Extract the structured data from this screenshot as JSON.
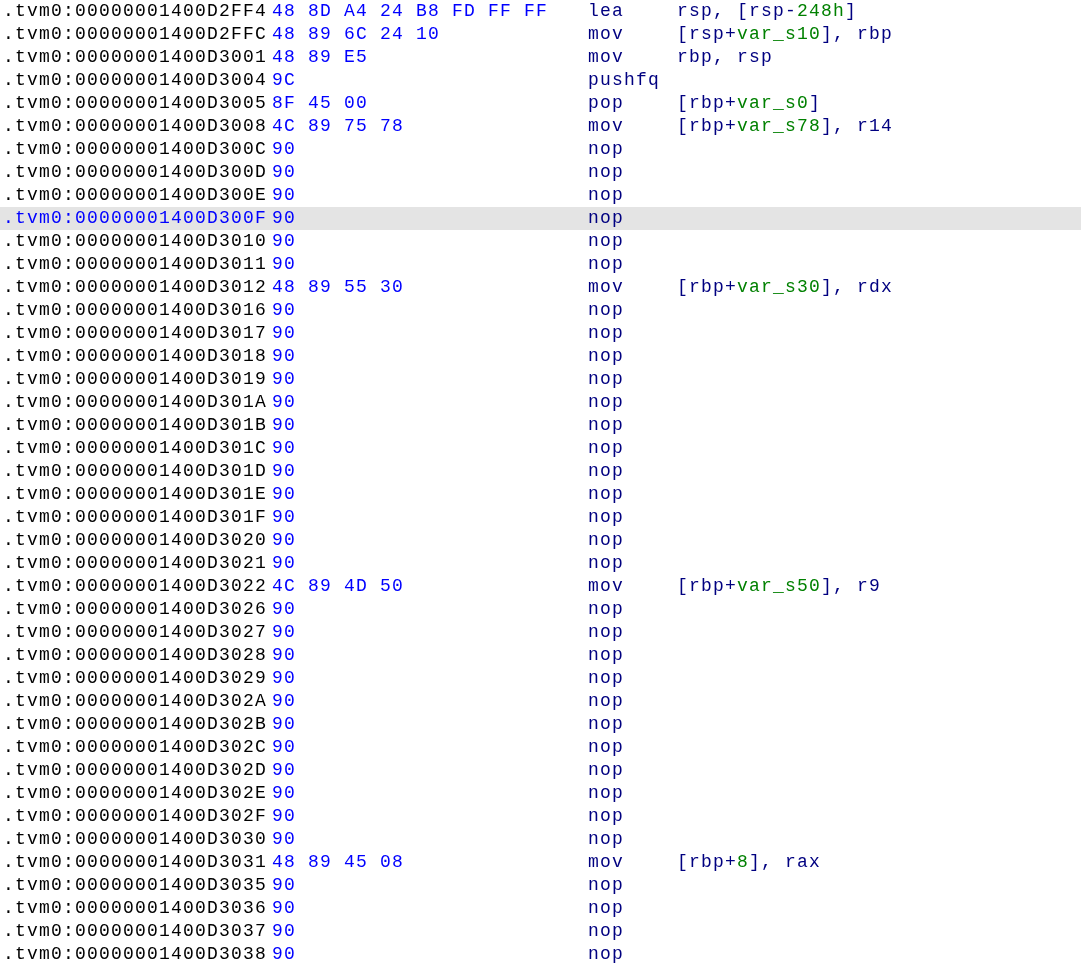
{
  "listing": {
    "rows": [
      {
        "address": ".tvm0:00000001400D2FF4",
        "bytes": "48 8D A4 24 B8 FD FF FF",
        "mnemonic": "lea",
        "operands": [
          {
            "text": "rsp, [rsp-",
            "kind": "plain"
          },
          {
            "text": "248h",
            "kind": "symbol"
          },
          {
            "text": "]",
            "kind": "plain"
          }
        ],
        "selected": false
      },
      {
        "address": ".tvm0:00000001400D2FFC",
        "bytes": "48 89 6C 24 10",
        "mnemonic": "mov",
        "operands": [
          {
            "text": "[rsp+",
            "kind": "plain"
          },
          {
            "text": "var_s10",
            "kind": "symbol"
          },
          {
            "text": "], rbp",
            "kind": "plain"
          }
        ],
        "selected": false
      },
      {
        "address": ".tvm0:00000001400D3001",
        "bytes": "48 89 E5",
        "mnemonic": "mov",
        "operands": [
          {
            "text": "rbp, rsp",
            "kind": "plain"
          }
        ],
        "selected": false
      },
      {
        "address": ".tvm0:00000001400D3004",
        "bytes": "9C",
        "mnemonic": "pushfq",
        "selected": false
      },
      {
        "address": ".tvm0:00000001400D3005",
        "bytes": "8F 45 00",
        "mnemonic": "pop",
        "operands": [
          {
            "text": "[rbp+",
            "kind": "plain"
          },
          {
            "text": "var_s0",
            "kind": "symbol"
          },
          {
            "text": "]",
            "kind": "plain"
          }
        ],
        "selected": false
      },
      {
        "address": ".tvm0:00000001400D3008",
        "bytes": "4C 89 75 78",
        "mnemonic": "mov",
        "operands": [
          {
            "text": "[rbp+",
            "kind": "plain"
          },
          {
            "text": "var_s78",
            "kind": "symbol"
          },
          {
            "text": "], r14",
            "kind": "plain"
          }
        ],
        "selected": false
      },
      {
        "address": ".tvm0:00000001400D300C",
        "bytes": "90",
        "mnemonic": "nop",
        "selected": false
      },
      {
        "address": ".tvm0:00000001400D300D",
        "bytes": "90",
        "mnemonic": "nop",
        "selected": false
      },
      {
        "address": ".tvm0:00000001400D300E",
        "bytes": "90",
        "mnemonic": "nop",
        "selected": false
      },
      {
        "address": ".tvm0:00000001400D300F",
        "bytes": "90",
        "mnemonic": "nop",
        "selected": true
      },
      {
        "address": ".tvm0:00000001400D3010",
        "bytes": "90",
        "mnemonic": "nop",
        "selected": false
      },
      {
        "address": ".tvm0:00000001400D3011",
        "bytes": "90",
        "mnemonic": "nop",
        "selected": false
      },
      {
        "address": ".tvm0:00000001400D3012",
        "bytes": "48 89 55 30",
        "mnemonic": "mov",
        "operands": [
          {
            "text": "[rbp+",
            "kind": "plain"
          },
          {
            "text": "var_s30",
            "kind": "symbol"
          },
          {
            "text": "], rdx",
            "kind": "plain"
          }
        ],
        "selected": false
      },
      {
        "address": ".tvm0:00000001400D3016",
        "bytes": "90",
        "mnemonic": "nop",
        "selected": false
      },
      {
        "address": ".tvm0:00000001400D3017",
        "bytes": "90",
        "mnemonic": "nop",
        "selected": false
      },
      {
        "address": ".tvm0:00000001400D3018",
        "bytes": "90",
        "mnemonic": "nop",
        "selected": false
      },
      {
        "address": ".tvm0:00000001400D3019",
        "bytes": "90",
        "mnemonic": "nop",
        "selected": false
      },
      {
        "address": ".tvm0:00000001400D301A",
        "bytes": "90",
        "mnemonic": "nop",
        "selected": false
      },
      {
        "address": ".tvm0:00000001400D301B",
        "bytes": "90",
        "mnemonic": "nop",
        "selected": false
      },
      {
        "address": ".tvm0:00000001400D301C",
        "bytes": "90",
        "mnemonic": "nop",
        "selected": false
      },
      {
        "address": ".tvm0:00000001400D301D",
        "bytes": "90",
        "mnemonic": "nop",
        "selected": false
      },
      {
        "address": ".tvm0:00000001400D301E",
        "bytes": "90",
        "mnemonic": "nop",
        "selected": false
      },
      {
        "address": ".tvm0:00000001400D301F",
        "bytes": "90",
        "mnemonic": "nop",
        "selected": false
      },
      {
        "address": ".tvm0:00000001400D3020",
        "bytes": "90",
        "mnemonic": "nop",
        "selected": false
      },
      {
        "address": ".tvm0:00000001400D3021",
        "bytes": "90",
        "mnemonic": "nop",
        "selected": false
      },
      {
        "address": ".tvm0:00000001400D3022",
        "bytes": "4C 89 4D 50",
        "mnemonic": "mov",
        "operands": [
          {
            "text": "[rbp+",
            "kind": "plain"
          },
          {
            "text": "var_s50",
            "kind": "symbol"
          },
          {
            "text": "], r9",
            "kind": "plain"
          }
        ],
        "selected": false
      },
      {
        "address": ".tvm0:00000001400D3026",
        "bytes": "90",
        "mnemonic": "nop",
        "selected": false
      },
      {
        "address": ".tvm0:00000001400D3027",
        "bytes": "90",
        "mnemonic": "nop",
        "selected": false
      },
      {
        "address": ".tvm0:00000001400D3028",
        "bytes": "90",
        "mnemonic": "nop",
        "selected": false
      },
      {
        "address": ".tvm0:00000001400D3029",
        "bytes": "90",
        "mnemonic": "nop",
        "selected": false
      },
      {
        "address": ".tvm0:00000001400D302A",
        "bytes": "90",
        "mnemonic": "nop",
        "selected": false
      },
      {
        "address": ".tvm0:00000001400D302B",
        "bytes": "90",
        "mnemonic": "nop",
        "selected": false
      },
      {
        "address": ".tvm0:00000001400D302C",
        "bytes": "90",
        "mnemonic": "nop",
        "selected": false
      },
      {
        "address": ".tvm0:00000001400D302D",
        "bytes": "90",
        "mnemonic": "nop",
        "selected": false
      },
      {
        "address": ".tvm0:00000001400D302E",
        "bytes": "90",
        "mnemonic": "nop",
        "selected": false
      },
      {
        "address": ".tvm0:00000001400D302F",
        "bytes": "90",
        "mnemonic": "nop",
        "selected": false
      },
      {
        "address": ".tvm0:00000001400D3030",
        "bytes": "90",
        "mnemonic": "nop",
        "selected": false
      },
      {
        "address": ".tvm0:00000001400D3031",
        "bytes": "48 89 45 08",
        "mnemonic": "mov",
        "operands": [
          {
            "text": "[rbp+",
            "kind": "plain"
          },
          {
            "text": "8",
            "kind": "symbol"
          },
          {
            "text": "], rax",
            "kind": "plain"
          }
        ],
        "selected": false
      },
      {
        "address": ".tvm0:00000001400D3035",
        "bytes": "90",
        "mnemonic": "nop",
        "selected": false
      },
      {
        "address": ".tvm0:00000001400D3036",
        "bytes": "90",
        "mnemonic": "nop",
        "selected": false
      },
      {
        "address": ".tvm0:00000001400D3037",
        "bytes": "90",
        "mnemonic": "nop",
        "selected": false
      },
      {
        "address": ".tvm0:00000001400D3038",
        "bytes": "90",
        "mnemonic": "nop",
        "selected": false
      }
    ]
  }
}
